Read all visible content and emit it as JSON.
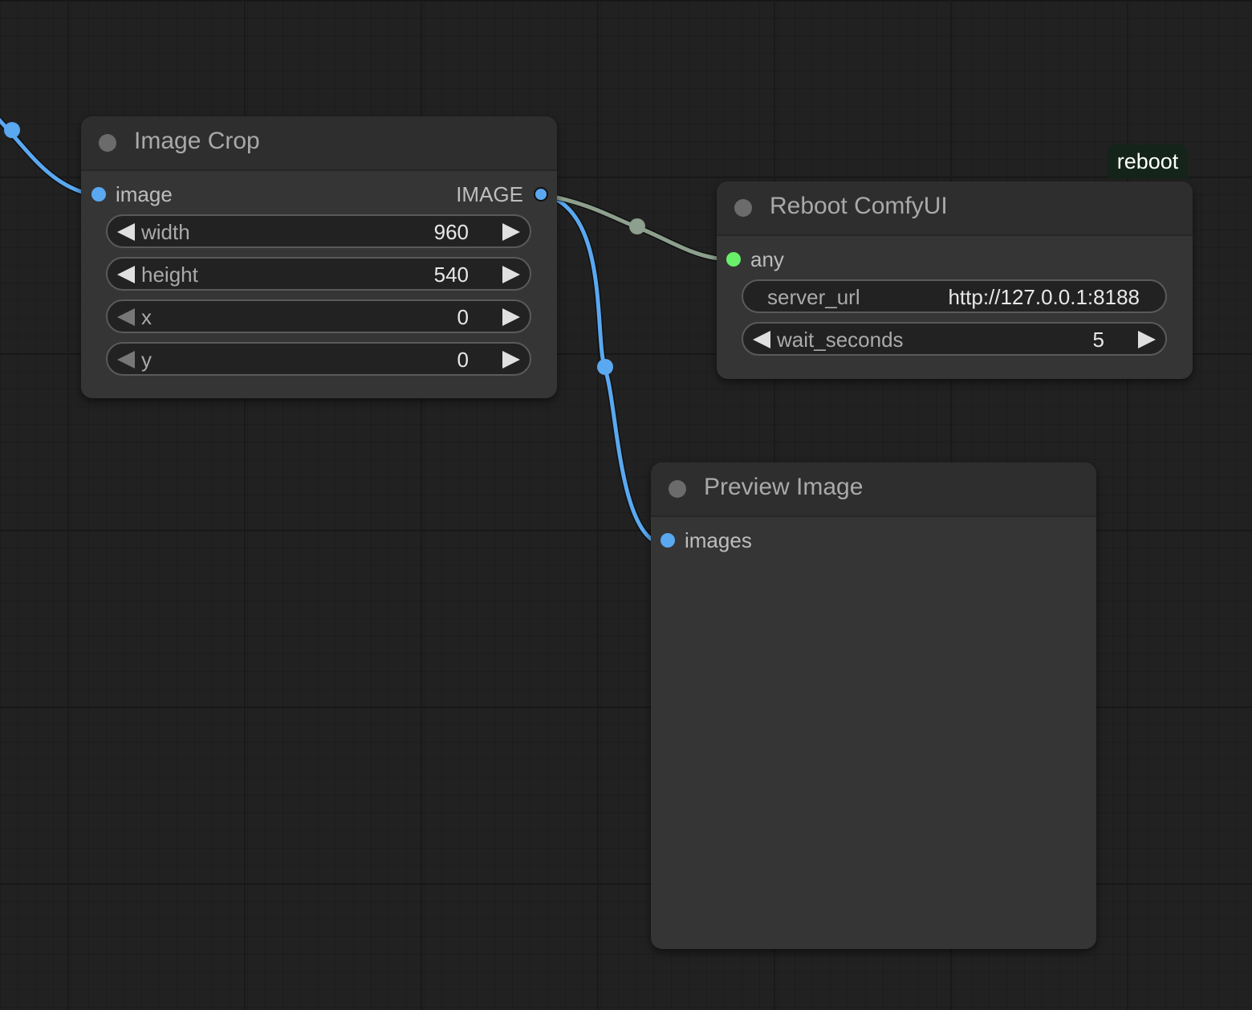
{
  "nodes": {
    "image_crop": {
      "title": "Image Crop",
      "input_label": "image",
      "output_label": "IMAGE",
      "widgets": [
        {
          "label": "width",
          "value": "960"
        },
        {
          "label": "height",
          "value": "540"
        },
        {
          "label": "x",
          "value": "0"
        },
        {
          "label": "y",
          "value": "0"
        }
      ]
    },
    "reboot": {
      "title": "Reboot ComfyUI",
      "badge": "reboot",
      "input_label": "any",
      "widgets": [
        {
          "label": "server_url",
          "value": "http://127.0.0.1:8188"
        },
        {
          "label": "wait_seconds",
          "value": "5"
        }
      ]
    },
    "preview": {
      "title": "Preview Image",
      "input_label": "images"
    }
  },
  "colors": {
    "image_link": "#5aa8f0",
    "any_link": "#8d9f8d",
    "any_slot": "#69ef69",
    "canvas": "#212121",
    "node_body": "#353535"
  }
}
